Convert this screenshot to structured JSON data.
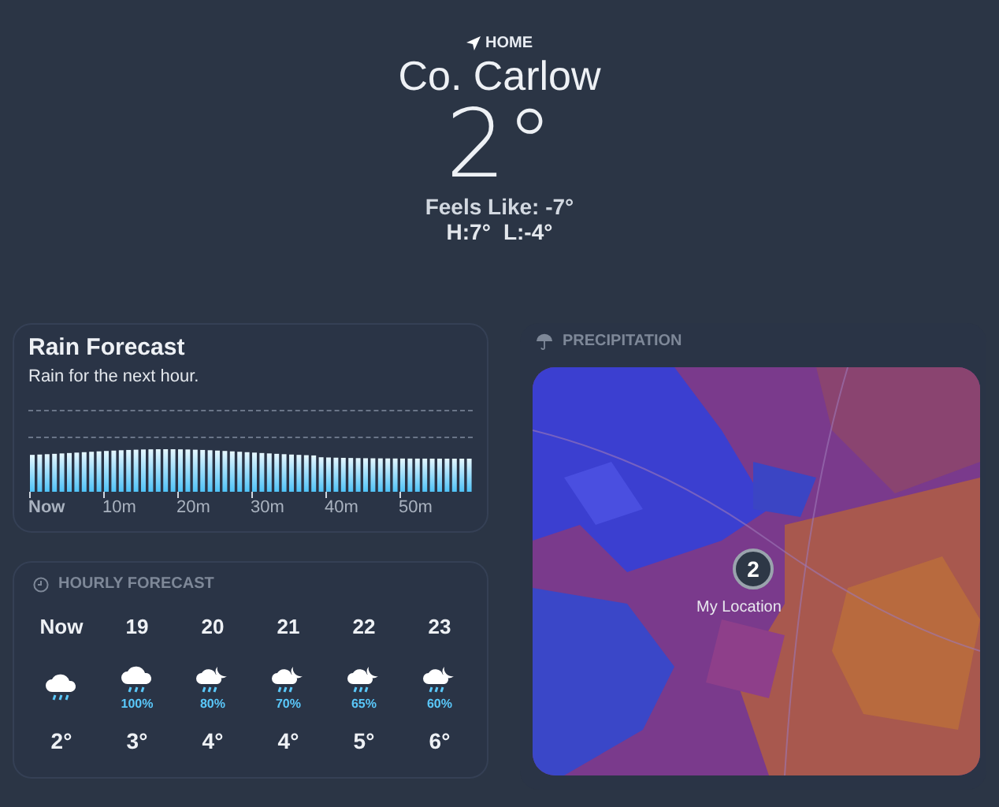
{
  "header": {
    "label": "HOME",
    "place": "Co. Carlow",
    "temperature": "2°",
    "feels_like": "Feels Like: -7°",
    "high": "H:7°",
    "low": "L:-4°"
  },
  "rain_forecast": {
    "title": "Rain Forecast",
    "summary": "Rain for the next hour.",
    "ticks": [
      "Now",
      "10m",
      "20m",
      "30m",
      "40m",
      "50m"
    ]
  },
  "hourly_forecast": {
    "title": "HOURLY FORECAST",
    "hours": [
      {
        "time": "Now",
        "kind": "rain",
        "temperature": "2°"
      },
      {
        "time": "19",
        "kind": "rain",
        "chance": "100%",
        "temperature": "3°"
      },
      {
        "time": "20",
        "kind": "night-rain",
        "chance": "80%",
        "temperature": "4°"
      },
      {
        "time": "21",
        "kind": "night-rain",
        "chance": "70%",
        "temperature": "4°"
      },
      {
        "time": "22",
        "kind": "night-rain",
        "chance": "65%",
        "temperature": "5°"
      },
      {
        "time": "23",
        "kind": "night-rain",
        "chance": "60%",
        "temperature": "6°"
      }
    ]
  },
  "precipitation": {
    "title": "PRECIPITATION",
    "map": {
      "kind": "picture",
      "pin_value": "2",
      "pin_label": "My Location"
    }
  }
}
